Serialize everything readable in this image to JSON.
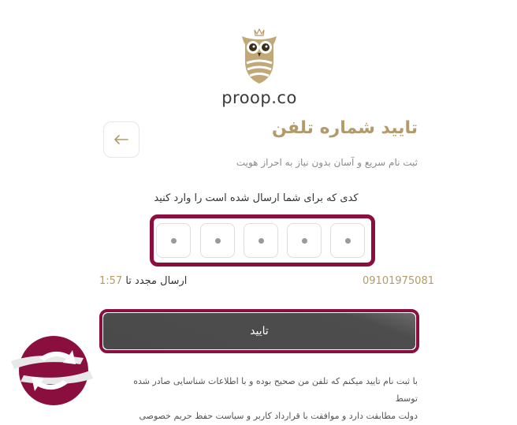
{
  "brand": {
    "logo_text": "proop.co",
    "accent_color": "#b39a6a",
    "highlight_color": "#8b0f3e"
  },
  "header": {
    "title": "تایید شماره تلفن",
    "subtitle": "ثبت نام سریع و آسان بدون نیاز به احراز هویت",
    "back_icon": "arrow-left-icon"
  },
  "otp": {
    "instruction": "کدی که برای شما ارسال شده است را وارد کنید",
    "digits": [
      "•",
      "•",
      "•",
      "•",
      "•"
    ]
  },
  "resend": {
    "label": "ارسال مجدد تا",
    "timer": "1:57"
  },
  "phone_number": "09101975081",
  "submit": {
    "label": "تایید"
  },
  "terms": {
    "line1": "با ثبت نام تایید میکنم که تلفن من صحیح بوده و با اطلاعات شناسایی صادر شده توسط",
    "line2": "دولت مطابقت دارد و موافقت با قرارداد کاربر و سیاست حفظ حریم خصوصی"
  }
}
